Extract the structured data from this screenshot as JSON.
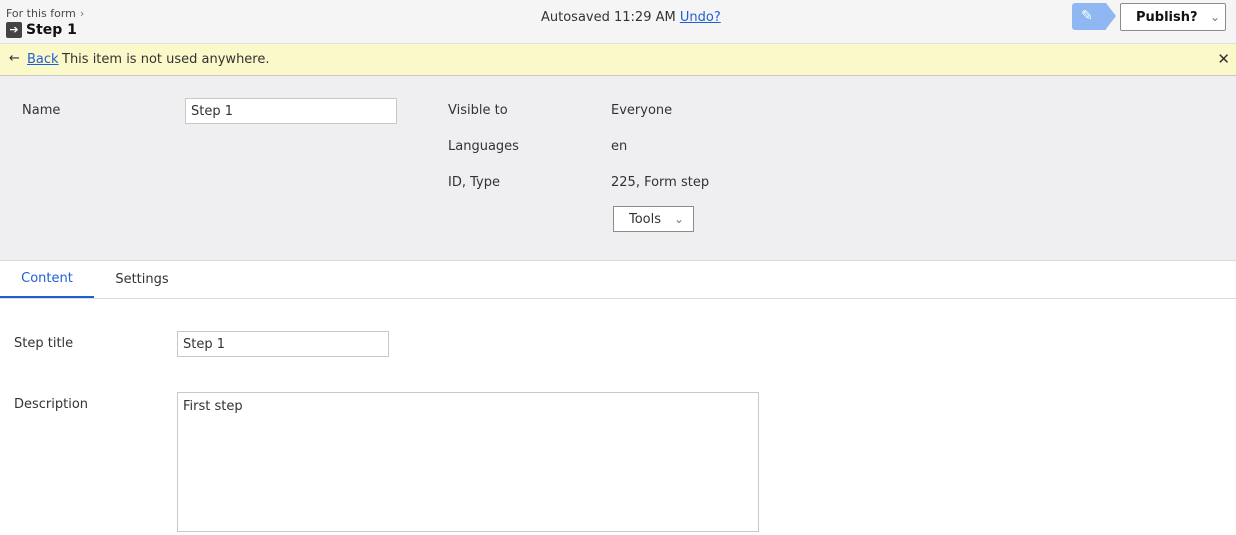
{
  "header": {
    "breadcrumb": "For this form",
    "type_icon_name": "form-step-icon",
    "title": "Step 1",
    "autosave_text": "Autosaved 11:29 AM",
    "undo_label": "Undo?",
    "publish_label": "Publish?"
  },
  "notice": {
    "back_label": "Back",
    "message": "This item is not used anywhere."
  },
  "info": {
    "name_label": "Name",
    "name_value": "Step 1",
    "visible_label": "Visible to",
    "visible_value": "Everyone",
    "languages_label": "Languages",
    "languages_value": "en",
    "id_type_label": "ID, Type",
    "id_type_value": "225, Form step",
    "tools_label": "Tools"
  },
  "tabs": [
    {
      "label": "Content",
      "active": true
    },
    {
      "label": "Settings",
      "active": false
    }
  ],
  "content": {
    "step_title_label": "Step title",
    "step_title_value": "Step 1",
    "description_label": "Description",
    "description_value": "First step"
  },
  "colors": {
    "accent": "#1f5fd6",
    "notice_bg": "#fbf8c9",
    "panel_bg": "#efeff1",
    "edit_button": "#8fb8f2"
  }
}
